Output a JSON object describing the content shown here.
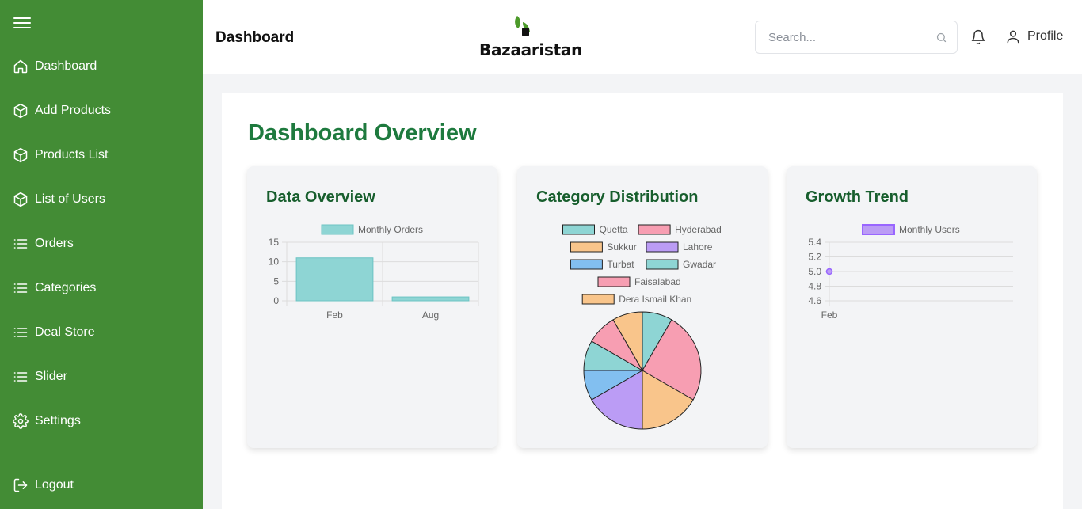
{
  "sidebar": {
    "items": [
      {
        "label": "Dashboard",
        "icon": "home-icon"
      },
      {
        "label": "Add Products",
        "icon": "box-icon"
      },
      {
        "label": "Products List",
        "icon": "box-icon"
      },
      {
        "label": "List of Users",
        "icon": "box-icon"
      },
      {
        "label": "Orders",
        "icon": "list-icon"
      },
      {
        "label": "Categories",
        "icon": "list-icon"
      },
      {
        "label": "Deal Store",
        "icon": "list-icon"
      },
      {
        "label": "Slider",
        "icon": "list-icon"
      },
      {
        "label": "Settings",
        "icon": "gear-icon"
      }
    ],
    "logout_label": "Logout"
  },
  "header": {
    "title": "Dashboard",
    "logo_text": "Bazaaristan",
    "search_placeholder": "Search...",
    "profile_label": "Profile"
  },
  "main": {
    "title": "Dashboard Overview",
    "cards": [
      {
        "title": "Data Overview"
      },
      {
        "title": "Category Distribution"
      },
      {
        "title": "Growth Trend"
      }
    ]
  },
  "colors": {
    "sidebar": "#438c35",
    "accent": "#1e7a3e",
    "card_title": "#175e2d"
  },
  "chart_data": [
    {
      "type": "bar",
      "categories": [
        "Feb",
        "Aug"
      ],
      "series": [
        {
          "name": "Monthly Orders",
          "values": [
            11,
            1
          ],
          "color": "#8ed5d4",
          "border": "#6cc4c3"
        }
      ],
      "ylim": [
        0,
        15
      ],
      "yticks": [
        0,
        5,
        10,
        15
      ],
      "legend": "top"
    },
    {
      "type": "pie",
      "labels": [
        "Quetta",
        "Hyderabad",
        "Sukkur",
        "Lahore",
        "Turbat",
        "Gwadar",
        "Faisalabad",
        "Dera Ismail Khan"
      ],
      "values": [
        1,
        3,
        2,
        2,
        1,
        1,
        1,
        1
      ],
      "colors": [
        "#8ed5d4",
        "#f79eb2",
        "#f9c58b",
        "#bb9cf5",
        "#82bff0",
        "#8ed5d4",
        "#f79eb2",
        "#f9c58b"
      ],
      "legend": "top"
    },
    {
      "type": "line",
      "categories": [
        "Feb"
      ],
      "series": [
        {
          "name": "Monthly Users",
          "values": [
            5
          ],
          "color": "#bb9cf5",
          "border": "#9966ff"
        }
      ],
      "ylim": [
        4.6,
        5.4
      ],
      "yticks": [
        4.6,
        4.8,
        5.0,
        5.2,
        5.4
      ],
      "legend": "top"
    }
  ]
}
